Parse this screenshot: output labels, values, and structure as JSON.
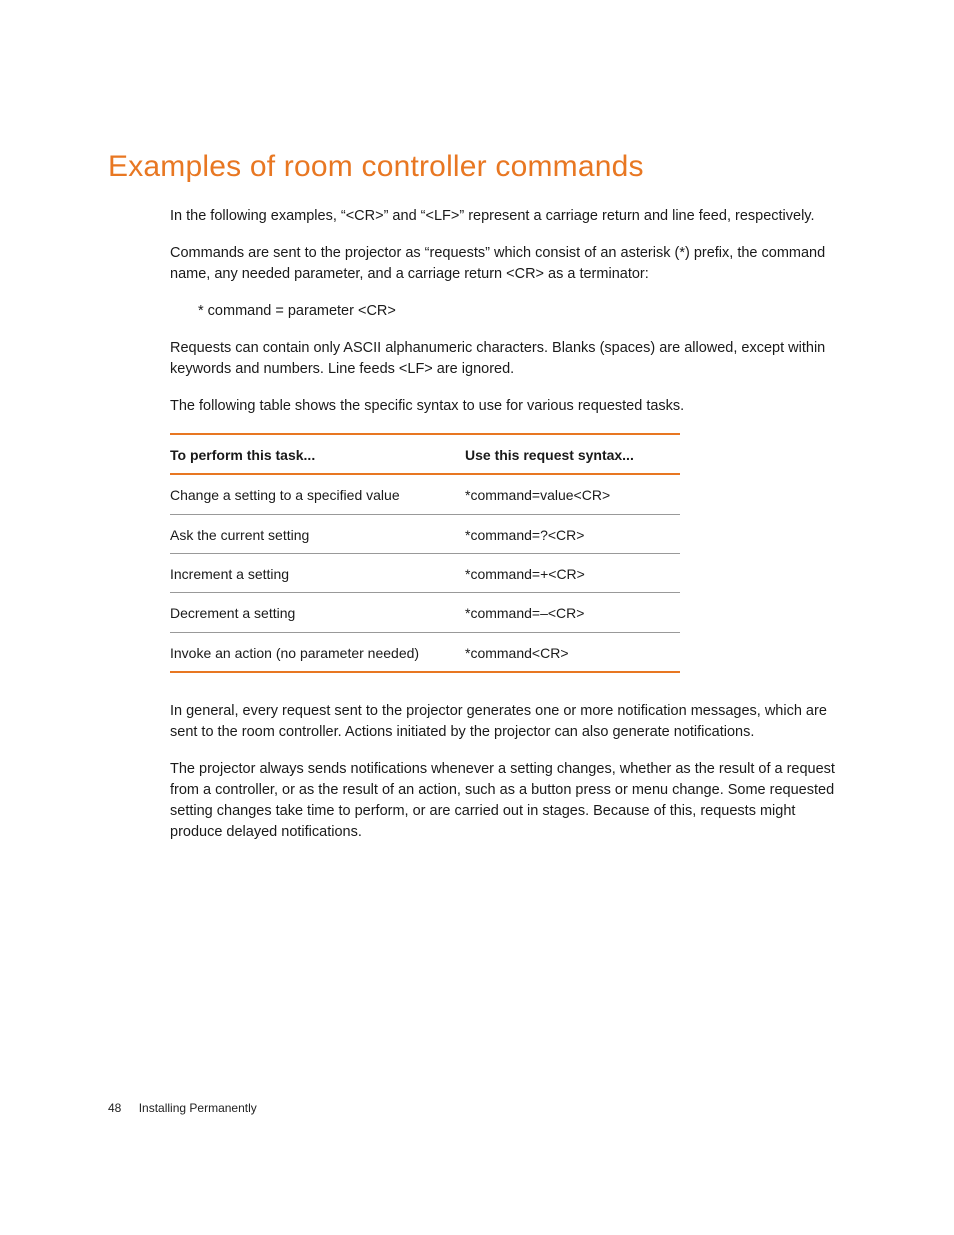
{
  "heading": "Examples of room controller commands",
  "paragraphs": {
    "p1": "In the following examples, “<CR>” and “<LF>” represent a carriage return and line feed, respectively.",
    "p2": "Commands are sent to the projector as “requests” which consist of an asterisk (*) prefix, the command name, any needed parameter, and a carriage return <CR> as a terminator:",
    "syntax_line": "* command = parameter <CR>",
    "p3": "Requests can contain only ASCII alphanumeric characters. Blanks (spaces) are allowed, except within keywords and numbers. Line feeds <LF> are ignored.",
    "p4": "The following table shows the specific syntax to use for various requested tasks.",
    "p5": "In general, every request sent to the projector generates one or more notification messages, which are sent to the room controller. Actions initiated by the projector can also generate notifications.",
    "p6": "The projector always sends notifications whenever a setting changes, whether as the result of a request from a controller, or as the result of an action, such as a button press or menu change. Some requested setting changes take time to perform, or are carried out in stages. Because of this, requests might produce delayed notifications."
  },
  "table": {
    "header": {
      "col1": "To perform this task...",
      "col2": "Use this request syntax..."
    },
    "rows": [
      {
        "task": "Change a setting to a specified value",
        "syntax": "*command=value<CR>"
      },
      {
        "task": "Ask the current setting",
        "syntax": "*command=?<CR>"
      },
      {
        "task": "Increment a setting",
        "syntax": "*command=+<CR>"
      },
      {
        "task": "Decrement a setting",
        "syntax": "*command=–<CR>"
      },
      {
        "task": "Invoke an action (no parameter needed)",
        "syntax": "*command<CR>"
      }
    ]
  },
  "footer": {
    "page_number": "48",
    "section": "Installing Permanently"
  }
}
